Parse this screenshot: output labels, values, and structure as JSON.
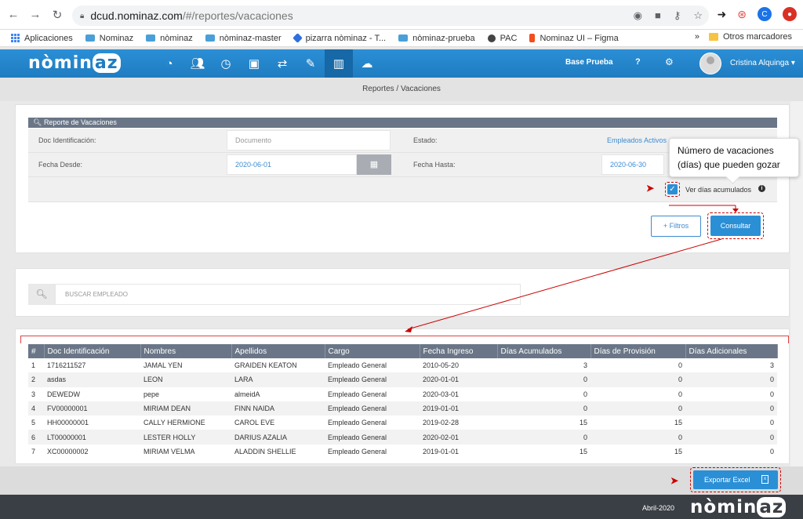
{
  "browser": {
    "url_host": "dcud.nominaz.com",
    "url_path": "/#/reportes/vacaciones",
    "profile_initial": "C",
    "bookmarks": [
      {
        "label": "Aplicaciones",
        "icon": "apps-icon"
      },
      {
        "label": "Nominaz",
        "icon": "cloud-icon"
      },
      {
        "label": "nòminaz",
        "icon": "cloud-icon"
      },
      {
        "label": "nòminaz-master",
        "icon": "cloud-icon"
      },
      {
        "label": "pizarra nòminaz - T...",
        "icon": "diamond-icon"
      },
      {
        "label": "nòminaz-prueba",
        "icon": "cloud-icon"
      },
      {
        "label": "PAC",
        "icon": "globe-icon"
      },
      {
        "label": "Nominaz UI – Figma",
        "icon": "figma-icon"
      }
    ],
    "more_bookmarks": "»",
    "other_bookmarks": "Otros marcadores"
  },
  "nav": {
    "logo_pre": "nòmin",
    "logo_az": "az",
    "company": "Base Prueba",
    "help": "?",
    "user_name": "Cristina Alquinga ▾",
    "icons": [
      "dashboard-icon",
      "users-icon",
      "clock-icon",
      "briefcase-icon",
      "handshake-icon",
      "edit-icon",
      "chart-icon",
      "cloud-upload-icon"
    ]
  },
  "breadcrumb": "Reportes / Vacaciones",
  "filters": {
    "panel_title": "Reporte de Vacaciones",
    "doc_label": "Doc Identificación:",
    "doc_placeholder": "Documento",
    "estado_label": "Estado:",
    "estado_value": "Empleados Activos",
    "fecha_desde_label": "Fecha Desde:",
    "fecha_desde_value": "2020-06-01",
    "fecha_hasta_label": "Fecha Hasta:",
    "fecha_hasta_value": "2020-06-30",
    "checkbox_label": "Ver días acumulados",
    "checkbox_checked": true,
    "filtros_button": "+ Filtros",
    "consultar_button": "Consultar"
  },
  "tooltip": {
    "line1": "Número de vacaciones",
    "line2": "(días) que pueden gozar"
  },
  "search": {
    "placeholder": "BUSCAR EMPLEADO"
  },
  "table": {
    "columns": [
      "#",
      "Doc Identificación",
      "Nombres",
      "Apellidos",
      "Cargo",
      "Fecha Ingreso",
      "Días Acumulados",
      "Días de Provisión",
      "Días Adicionales"
    ],
    "rows": [
      [
        "1",
        "1716211527",
        "JAMAL YEN",
        "GRAIDEN KEATON",
        "Empleado General",
        "2010-05-20",
        "3",
        "0",
        "3"
      ],
      [
        "2",
        "asdas",
        "LEON",
        "LARA",
        "Empleado General",
        "2020-01-01",
        "0",
        "0",
        "0"
      ],
      [
        "3",
        "DEWEDW",
        "pepe",
        "almeidA",
        "Empleado General",
        "2020-03-01",
        "0",
        "0",
        "0"
      ],
      [
        "4",
        "FV00000001",
        "MIRIAM DEAN",
        "FINN NAIDA",
        "Empleado General",
        "2019-01-01",
        "0",
        "0",
        "0"
      ],
      [
        "5",
        "HH00000001",
        "CALLY HERMIONE",
        "CAROL EVE",
        "Empleado General",
        "2019-02-28",
        "15",
        "15",
        "0"
      ],
      [
        "6",
        "LT00000001",
        "LESTER HOLLY",
        "DARIUS AZALIA",
        "Empleado General",
        "2020-02-01",
        "0",
        "0",
        "0"
      ],
      [
        "7",
        "XC00000002",
        "MIRIAM VELMA",
        "ALADDIN SHELLIE",
        "Empleado General",
        "2019-01-01",
        "15",
        "15",
        "0"
      ]
    ]
  },
  "footer": {
    "export_button": "Exportar Excel",
    "date": "Abril-2020",
    "logo_pre": "nòmin",
    "logo_az": "az"
  },
  "colors": {
    "primary": "#2b8fd6",
    "panel_header": "#6a7687",
    "annotation_red": "#cc0000",
    "footer_dark": "#3a3e45"
  }
}
